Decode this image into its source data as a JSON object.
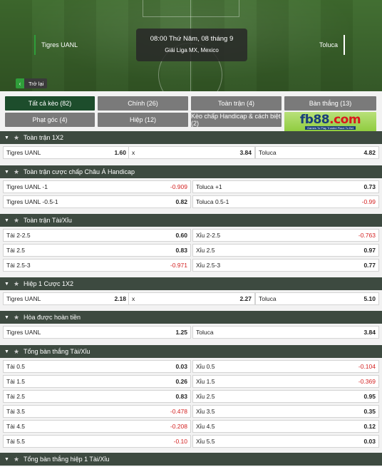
{
  "match": {
    "home": "Tigres UANL",
    "away": "Toluca",
    "time": "08:00 Thứ Năm, 08 tháng 9",
    "league": "Giải Liga MX, Mexico",
    "back_label": "Trở lại"
  },
  "tabs": [
    {
      "label": "Tất cả kèo (82)",
      "active": true
    },
    {
      "label": "Chính (26)"
    },
    {
      "label": "Toàn trận (4)"
    },
    {
      "label": "Bàn thắng (13)"
    },
    {
      "label": "Phạt góc (4)"
    },
    {
      "label": "Hiệp (12)"
    },
    {
      "label": "Kèo chấp Handicap & cách biệt (2)"
    }
  ],
  "ad": {
    "logo_main": "fb88",
    "logo_tld": ".com",
    "tagline": "Games To Play   Trusted Place To Bet"
  },
  "sections": [
    {
      "title": "Toàn trận 1X2",
      "type": "three",
      "rows": [
        [
          {
            "name": "Tigres UANL",
            "odd": "1.60"
          },
          {
            "name": "x",
            "odd": "3.84"
          },
          {
            "name": "Toluca",
            "odd": "4.82"
          }
        ]
      ]
    },
    {
      "title": "Toàn trận cược chấp Châu Á Handicap",
      "type": "two",
      "rows": [
        [
          {
            "name": "Tigres UANL",
            "line": "-1",
            "odd": "-0.909"
          },
          {
            "name": "Toluca",
            "line": "+1",
            "odd": "0.73"
          }
        ],
        [
          {
            "name": "Tigres UANL",
            "line": "-0.5-1",
            "odd": "0.82"
          },
          {
            "name": "Toluca",
            "line": "0.5-1",
            "odd": "-0.99"
          }
        ]
      ]
    },
    {
      "title": "Toàn trận Tài/Xỉu",
      "type": "two",
      "rows": [
        [
          {
            "name": "Tài",
            "line": "2-2.5",
            "odd": "0.60"
          },
          {
            "name": "Xỉu",
            "line": "2-2.5",
            "odd": "-0.763"
          }
        ],
        [
          {
            "name": "Tài",
            "line": "2.5",
            "odd": "0.83"
          },
          {
            "name": "Xỉu",
            "line": "2.5",
            "odd": "0.97"
          }
        ],
        [
          {
            "name": "Tài",
            "line": "2.5-3",
            "odd": "-0.971"
          },
          {
            "name": "Xỉu",
            "line": "2.5-3",
            "odd": "0.77"
          }
        ]
      ]
    },
    {
      "title": "Hiệp 1 Cược 1X2",
      "type": "three",
      "rows": [
        [
          {
            "name": "Tigres UANL",
            "odd": "2.18"
          },
          {
            "name": "x",
            "odd": "2.27"
          },
          {
            "name": "Toluca",
            "odd": "5.10"
          }
        ]
      ]
    },
    {
      "title": "Hòa được hoàn tiền",
      "type": "two",
      "rows": [
        [
          {
            "name": "Tigres UANL",
            "line": "",
            "odd": "1.25"
          },
          {
            "name": "Toluca",
            "line": "",
            "odd": "3.84"
          }
        ]
      ]
    },
    {
      "title": "Tổng bàn thắng Tài/Xỉu",
      "type": "two",
      "rows": [
        [
          {
            "name": "Tài",
            "line": "0.5",
            "odd": "0.03"
          },
          {
            "name": "Xỉu",
            "line": "0.5",
            "odd": "-0.104"
          }
        ],
        [
          {
            "name": "Tài",
            "line": "1.5",
            "odd": "0.26"
          },
          {
            "name": "Xỉu",
            "line": "1.5",
            "odd": "-0.369"
          }
        ],
        [
          {
            "name": "Tài",
            "line": "2.5",
            "odd": "0.83"
          },
          {
            "name": "Xỉu",
            "line": "2.5",
            "odd": "0.95"
          }
        ],
        [
          {
            "name": "Tài",
            "line": "3.5",
            "odd": "-0.478"
          },
          {
            "name": "Xỉu",
            "line": "3.5",
            "odd": "0.35"
          }
        ],
        [
          {
            "name": "Tài",
            "line": "4.5",
            "odd": "-0.208"
          },
          {
            "name": "Xỉu",
            "line": "4.5",
            "odd": "0.12"
          }
        ],
        [
          {
            "name": "Tài",
            "line": "5.5",
            "odd": "-0.10"
          },
          {
            "name": "Xỉu",
            "line": "5.5",
            "odd": "0.03"
          }
        ]
      ]
    },
    {
      "title": "Tổng bàn thắng hiệp 1 Tài/Xỉu",
      "type": "two",
      "rows": []
    }
  ],
  "colors": {
    "header_bg": "#3d4a40",
    "tab_active": "#1d4d2c",
    "tab_bg": "#7a7a7a",
    "negative": "#d32222",
    "accent_green": "#2f9e3a"
  }
}
